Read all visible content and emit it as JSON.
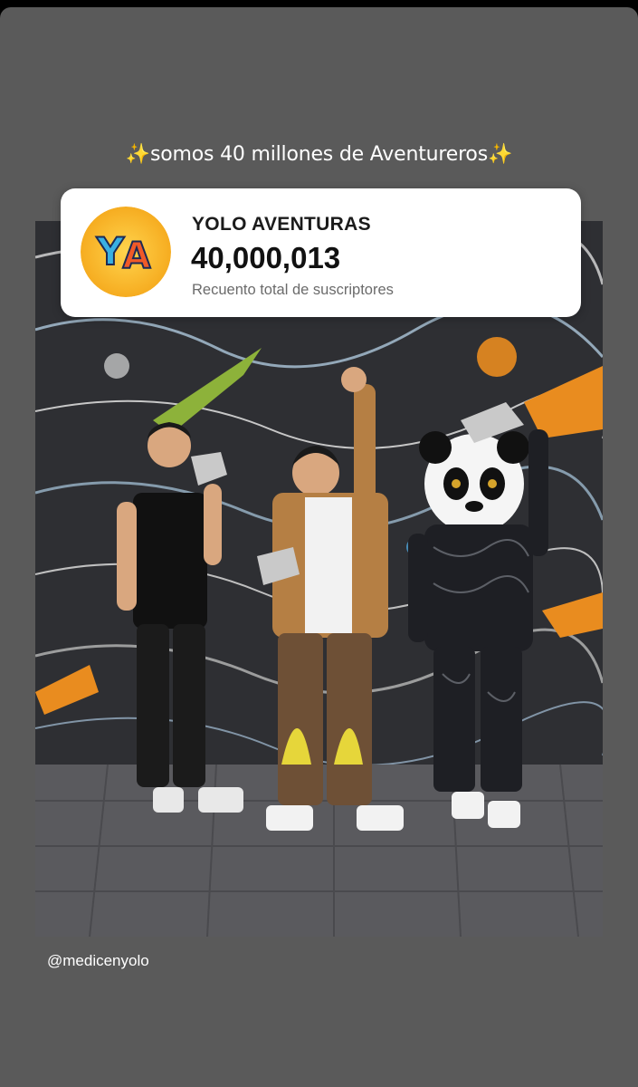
{
  "story": {
    "caption": "✨somos 40 millones de Aventureros✨",
    "mention": "@medicenyolo"
  },
  "subscriber_card": {
    "avatar_text": "YA",
    "channel_name": "YOLO AVENTURAS",
    "subscriber_count": "40,000,013",
    "count_label": "Recuento total de suscriptores"
  },
  "photo": {
    "description_icon": "group-photo-with-play-buttons"
  },
  "colors": {
    "background": "#5a5a5a",
    "card": "#ffffff",
    "avatar_bg": "#f7b21b",
    "avatar_y": "#42b3e0",
    "avatar_a": "#f05a28"
  }
}
